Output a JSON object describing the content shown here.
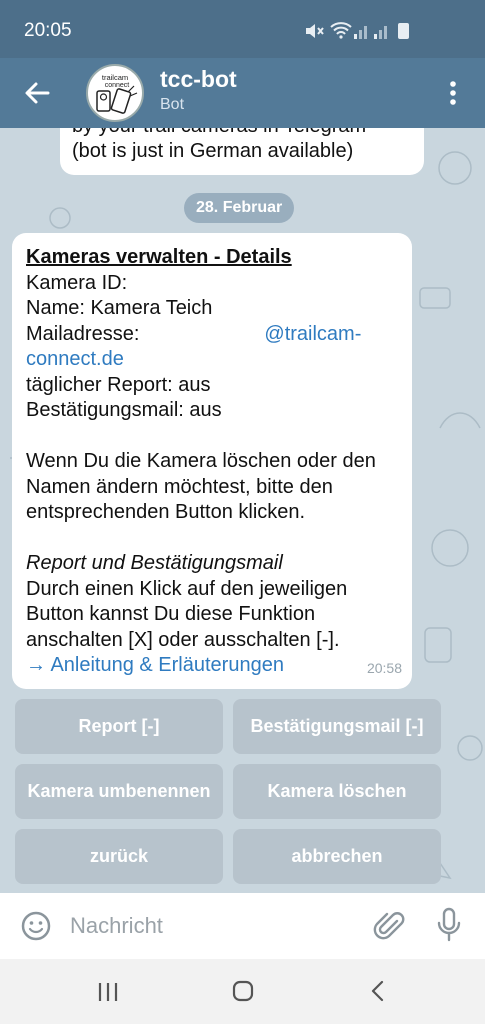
{
  "status_bar": {
    "time": "20:05"
  },
  "app_bar": {
    "title": "tcc-bot",
    "subtitle": "Bot",
    "avatar_text": "trailcam connect"
  },
  "chat": {
    "previous_message": {
      "line1": "by your trail cameras in Telegram",
      "line2": "(bot is just in German available)"
    },
    "date_separator": "28. Februar",
    "message": {
      "heading": "Kameras verwalten - Details",
      "camera_id": "Kamera ID: ",
      "name": "Name: Kamera Teich",
      "mail_label": "Mailadresse:",
      "mail_value": "@trailcam-connect.de",
      "report": "täglicher Report: aus",
      "confirm": "Bestätigungsmail: aus",
      "paragraph": "Wenn Du die Kamera löschen oder den Namen ändern möchtest, bitte den entsprechenden Button klicken.",
      "italic_heading": "Report und Bestätigungsmail",
      "paragraph2": "Durch einen Klick auf den jeweiligen Button kannst Du diese Funktion anschalten [X] oder ausschalten [-].",
      "link": "→ Anleitung & Erläuterungen",
      "time": "20:58"
    }
  },
  "buttons": {
    "report": "Report  [-]",
    "confirmation_mail": "Bestätigungsmail  [-]",
    "rename": "Kamera umbenennen",
    "delete": "Kamera löschen",
    "back": "zurück",
    "cancel": "abbrechen"
  },
  "input": {
    "placeholder": "Nachricht"
  }
}
